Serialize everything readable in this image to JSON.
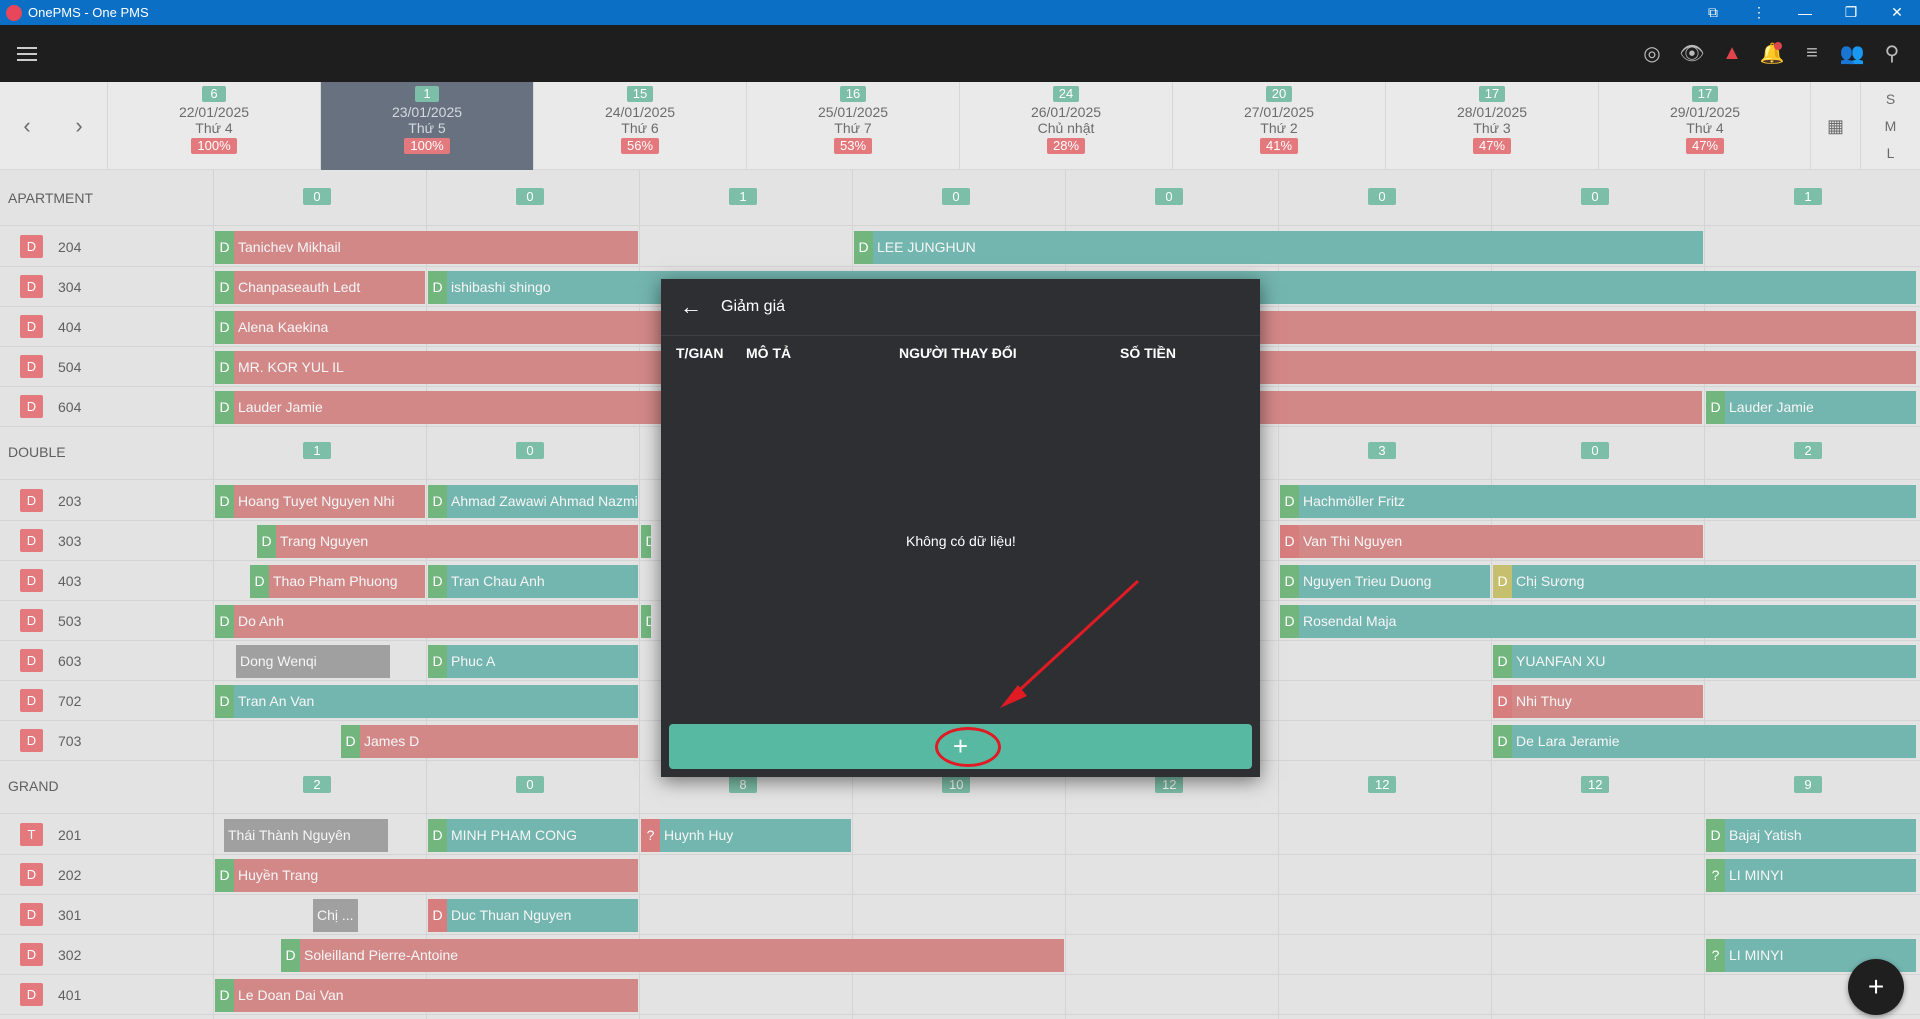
{
  "window": {
    "title": "OnePMS - One PMS",
    "controls": [
      "⧉",
      "⋮",
      "—",
      "❐",
      "✕"
    ]
  },
  "toolbar": {
    "icons": [
      "fingerprint-icon",
      "eye-icon",
      "warning-icon",
      "bell-icon",
      "list-icon",
      "add-user-icon",
      "search-icon"
    ]
  },
  "dates": [
    {
      "count": "6",
      "date": "22/01/2025",
      "weekday": "Thứ 4",
      "pct": "100%"
    },
    {
      "count": "1",
      "date": "23/01/2025",
      "weekday": "Thứ 5",
      "pct": "100%"
    },
    {
      "count": "15",
      "date": "24/01/2025",
      "weekday": "Thứ 6",
      "pct": "56%"
    },
    {
      "count": "16",
      "date": "25/01/2025",
      "weekday": "Thứ 7",
      "pct": "53%"
    },
    {
      "count": "24",
      "date": "26/01/2025",
      "weekday": "Chủ nhật",
      "pct": "28%"
    },
    {
      "count": "20",
      "date": "27/01/2025",
      "weekday": "Thứ 2",
      "pct": "41%"
    },
    {
      "count": "17",
      "date": "28/01/2025",
      "weekday": "Thứ 3",
      "pct": "47%"
    },
    {
      "count": "17",
      "date": "29/01/2025",
      "weekday": "Thứ 4",
      "pct": "47%"
    }
  ],
  "sizes": [
    "S",
    "M",
    "L"
  ],
  "groups": [
    {
      "name": "APARTMENT",
      "counts": [
        "0",
        "0",
        "1",
        "0",
        "0",
        "0",
        "0",
        "1"
      ]
    },
    {
      "name": "DOUBLE",
      "counts": [
        "1",
        "0",
        "",
        "",
        "",
        "3",
        "0",
        "2"
      ]
    },
    {
      "name": "GRAND",
      "counts": [
        "2",
        "0",
        "8",
        "10",
        "12",
        "12",
        "12",
        "9"
      ]
    }
  ],
  "rooms": [
    {
      "tag": "D",
      "no": "204"
    },
    {
      "tag": "D",
      "no": "304"
    },
    {
      "tag": "D",
      "no": "404"
    },
    {
      "tag": "D",
      "no": "504"
    },
    {
      "tag": "D",
      "no": "604"
    },
    {
      "tag": "D",
      "no": "203"
    },
    {
      "tag": "D",
      "no": "303"
    },
    {
      "tag": "D",
      "no": "403"
    },
    {
      "tag": "D",
      "no": "503"
    },
    {
      "tag": "D",
      "no": "603"
    },
    {
      "tag": "D",
      "no": "702"
    },
    {
      "tag": "D",
      "no": "703"
    },
    {
      "tag": "T",
      "no": "201"
    },
    {
      "tag": "D",
      "no": "202"
    },
    {
      "tag": "D",
      "no": "301"
    },
    {
      "tag": "D",
      "no": "302"
    },
    {
      "tag": "D",
      "no": "401"
    }
  ],
  "bookings": [
    {
      "st": "D",
      "name": "Tanichev Mikhail"
    },
    {
      "st": "D",
      "name": "LEE JUNGHUN"
    },
    {
      "st": "D",
      "name": "Chanpaseauth Ledt"
    },
    {
      "st": "D",
      "name": "ishibashi shingo"
    },
    {
      "st": "D",
      "name": "Alena Kaekina"
    },
    {
      "st": "D",
      "name": "MR. KOR YUL IL"
    },
    {
      "st": "D",
      "name": "Lauder Jamie"
    },
    {
      "st": "D",
      "name": "Lauder Jamie"
    },
    {
      "st": "D",
      "name": "Hoang Tuyet Nguyen Nhi"
    },
    {
      "st": "D",
      "name": "Ahmad Zawawi Ahmad Nazmi Bin"
    },
    {
      "st": "D",
      "name": "Hachmöller Fritz"
    },
    {
      "st": "D",
      "name": "Trang Nguyen"
    },
    {
      "st": "D",
      "name": ""
    },
    {
      "st": "D",
      "name": "Van Thi Nguyen"
    },
    {
      "st": "D",
      "name": "Thao Pham Phuong"
    },
    {
      "st": "D",
      "name": "Tran Chau Anh"
    },
    {
      "st": "D",
      "name": "Nguyen Trieu Duong"
    },
    {
      "st": "D",
      "name": "Chị Sương"
    },
    {
      "st": "D",
      "name": "Do Anh"
    },
    {
      "st": "D",
      "name": ""
    },
    {
      "st": "D",
      "name": "Rosendal Maja"
    },
    {
      "st": "",
      "name": "Dong Wenqi"
    },
    {
      "st": "D",
      "name": "Phuc A"
    },
    {
      "st": "D",
      "name": "YUANFAN XU"
    },
    {
      "st": "D",
      "name": "Tran An Van"
    },
    {
      "st": "D",
      "name": "Nhi Thuy"
    },
    {
      "st": "D",
      "name": "James D"
    },
    {
      "st": "D",
      "name": "De Lara Jeramie"
    },
    {
      "st": "",
      "name": "Thái Thành Nguyên"
    },
    {
      "st": "D",
      "name": "MINH PHAM CONG"
    },
    {
      "st": "?",
      "name": "Huynh Huy"
    },
    {
      "st": "D",
      "name": "Bajaj Yatish"
    },
    {
      "st": "D",
      "name": "Huyền Trang"
    },
    {
      "st": "?",
      "name": "LI MINYI"
    },
    {
      "st": "",
      "name": "Chị ..."
    },
    {
      "st": "D",
      "name": "Duc Thuan Nguyen"
    },
    {
      "st": "D",
      "name": "Soleilland Pierre-Antoine"
    },
    {
      "st": "?",
      "name": "LI MINYI"
    },
    {
      "st": "D",
      "name": "Le Doan Dai Van"
    }
  ],
  "modal": {
    "title": "Giảm giá",
    "columns": [
      "T/GIAN",
      "MÔ TẢ",
      "NGƯỜI THAY ĐỔI",
      "SỐ TIỀN"
    ],
    "empty_text": "Không có dữ liệu!",
    "add_label": "+"
  },
  "fab_label": "+",
  "colors": {
    "booking_red": "#c25b5b",
    "booking_teal": "#3e9991",
    "badge_green": "#4aa585",
    "badge_red": "#d9464c",
    "annotation_red": "#e01b24"
  }
}
